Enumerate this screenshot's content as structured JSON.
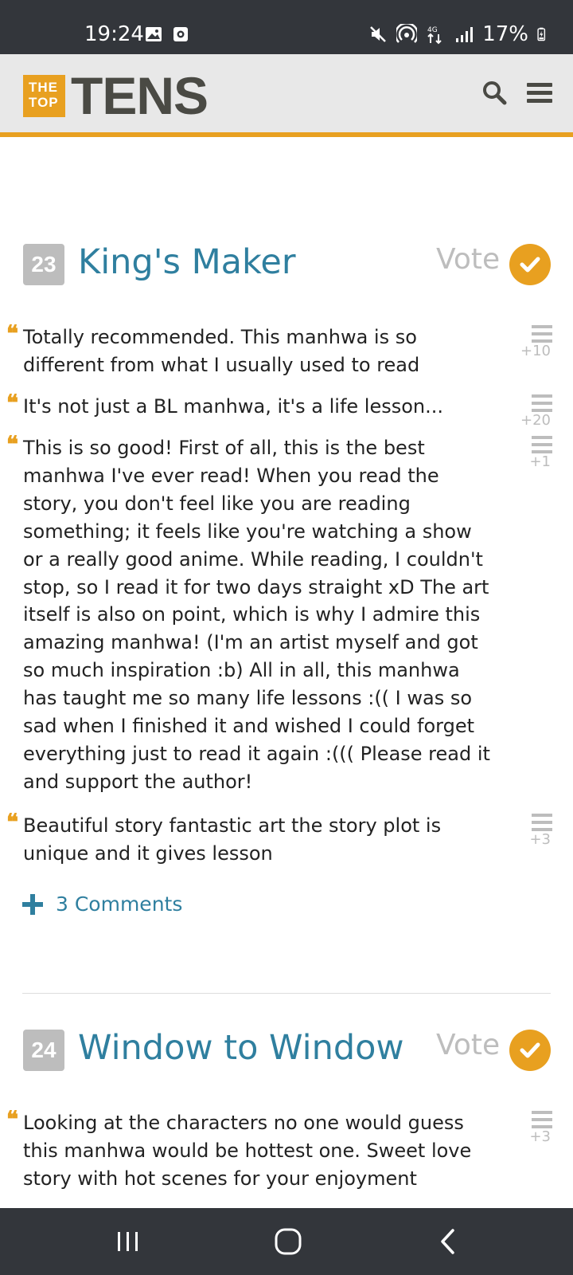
{
  "status_bar": {
    "time": "19:24",
    "network": "4G",
    "battery": "17%",
    "icons_left": [
      "image-icon",
      "screen-record-icon"
    ],
    "icons_right": [
      "mute-icon",
      "hotspot-icon",
      "network-arrows-icon",
      "signal-icon",
      "battery-charging-icon"
    ]
  },
  "header": {
    "logo_small_top": "THE",
    "logo_small_bottom": "TOP",
    "logo_word": "TENS",
    "accent_color": "#e8a020"
  },
  "items": [
    {
      "rank": "23",
      "title": "King's Maker",
      "vote_label": "Vote",
      "reviews": [
        {
          "text": "Totally recommended. This manhwa is so different from what I usually used to read",
          "score": "+10"
        },
        {
          "text": "It's not just a BL manhwa, it's a life lesson...",
          "score": "+20"
        },
        {
          "text": "This is so good! First of all, this is the best manhwa I've ever read! When you read the story, you don't feel like you are reading something; it feels like you're watching a show or a really good anime. While reading, I couldn't stop, so I read it for two days straight xD The art itself is also on point, which is why I admire this amazing manhwa! (I'm an artist myself and got so much inspiration :b) All in all, this manhwa has taught me so many life lessons :(( I was so sad when I finished it and wished I could forget everything just to read it again :((( Please read it and support the author!",
          "score": "+1"
        },
        {
          "text": "Beautiful story fantastic art the story plot is unique and it gives lesson",
          "score": "+3"
        }
      ],
      "comments_label": "3 Comments"
    },
    {
      "rank": "24",
      "title": "Window to Window",
      "vote_label": "Vote",
      "reviews": [
        {
          "text": "Looking at the characters no one would guess this manhwa would be hottest one. Sweet love story with hot scenes for your enjoyment",
          "score": "+3"
        }
      ]
    }
  ]
}
